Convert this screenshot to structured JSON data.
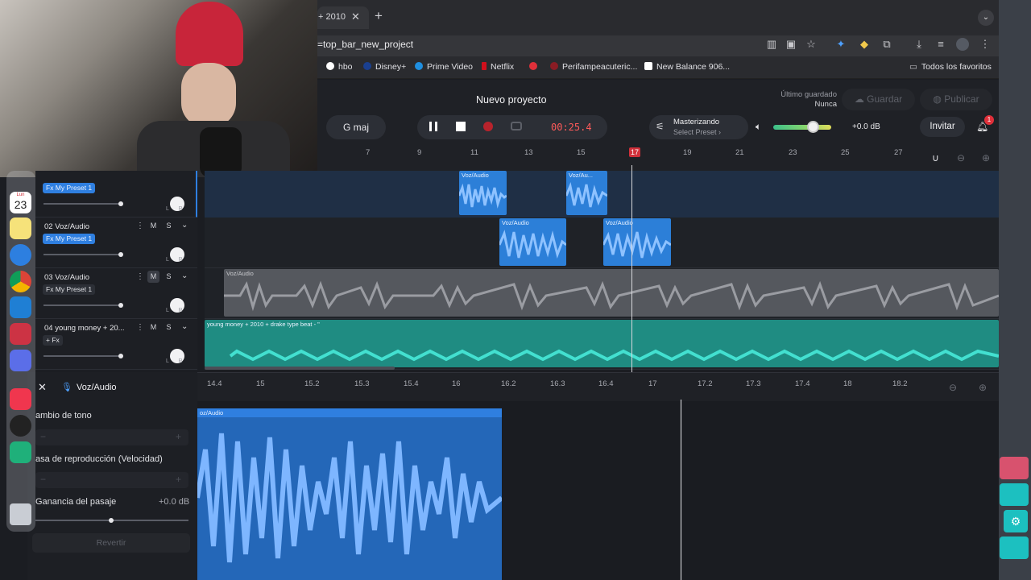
{
  "browser": {
    "tab_title": "+ 2010",
    "url": "=top_bar_new_project",
    "bookmarks": [
      "hbo",
      "Disney+",
      "Prime Video",
      "Netflix",
      "Perifampeacuteric...",
      "New Balance 906...",
      "Todos los favoritos"
    ]
  },
  "app": {
    "project_title": "Nuevo proyecto",
    "key": "G maj",
    "time": "00:25.4",
    "master_title": "Masterizando",
    "master_preset": "Select Preset",
    "gain": "+0.0 dB",
    "volume_level": 0.68,
    "last_saved_label": "Último guardado",
    "last_saved_value": "Nunca",
    "save": "Guardar",
    "publish": "Publicar",
    "invite": "Invitar",
    "notifications": "1"
  },
  "ruler": [
    "7",
    "9",
    "11",
    "13",
    "15",
    "17",
    "19",
    "21",
    "23",
    "25",
    "27"
  ],
  "tracks": [
    {
      "name": "",
      "fx": "Fx My Preset 1",
      "m": "M",
      "s": "S"
    },
    {
      "name": "02 Voz/Audio",
      "fx": "Fx My Preset 1",
      "m": "M",
      "s": "S"
    },
    {
      "name": "03 Voz/Audio",
      "fx": "Fx My Preset 1",
      "m": "M",
      "s": "S"
    },
    {
      "name": "04 young money + 20...",
      "fx": "+ Fx",
      "m": "M",
      "s": "S"
    }
  ],
  "clips": {
    "voz": "Voz/Audio",
    "voz_short": "Voz/Au...",
    "beat": "young money + 2010 + drake type beat - \""
  },
  "detail": {
    "title": "Voz/Audio",
    "pitch": "ambio de tono",
    "rate": "asa de reproducción (Velocidad)",
    "gain": "Ganancia del pasaje",
    "gain_value": "+0.0 dB",
    "revert": "Revertir",
    "ruler": [
      "14.4",
      "15",
      "15.2",
      "15.3",
      "15.4",
      "16",
      "16.2",
      "16.3",
      "16.4",
      "17",
      "17.2",
      "17.3",
      "17.4",
      "18",
      "18.2"
    ],
    "clip_label": "oz/Audio"
  },
  "dock": {
    "calendar_day": "23",
    "calendar_month": "Lun"
  }
}
